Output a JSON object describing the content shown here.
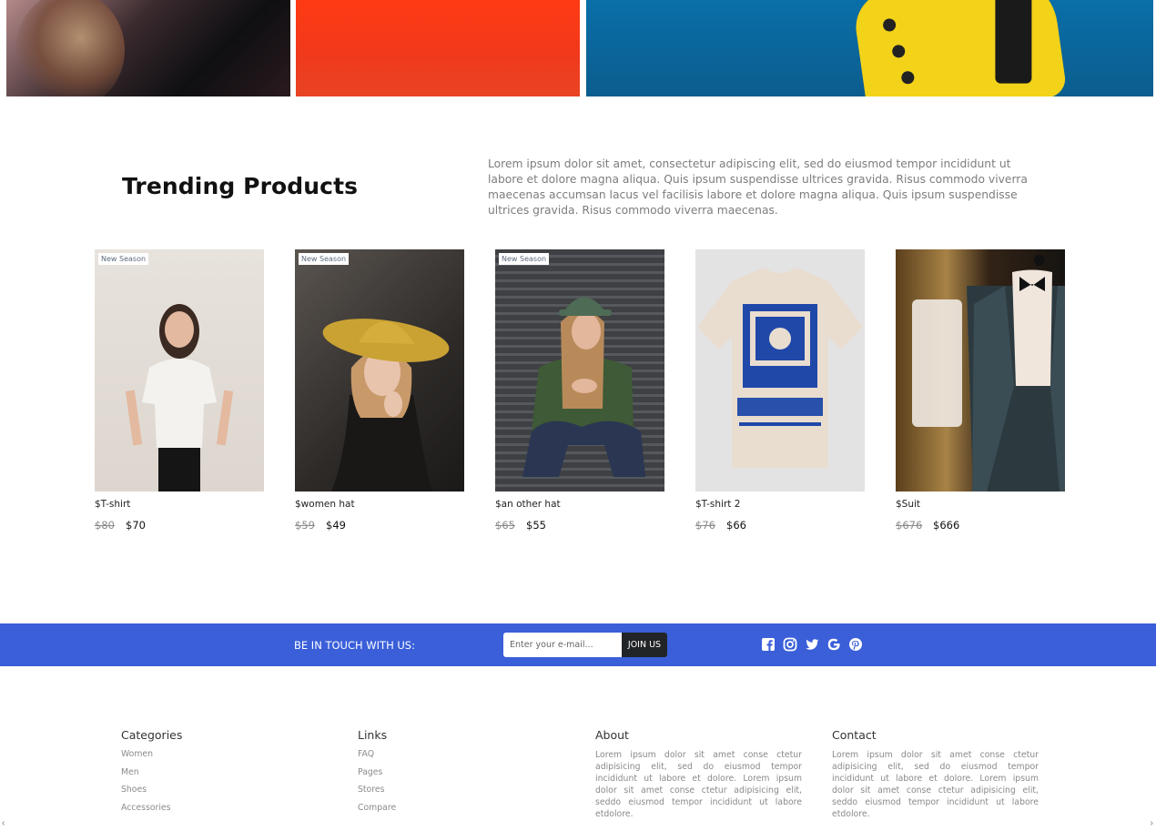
{
  "trending": {
    "title": "Trending Products",
    "description": "Lorem ipsum dolor sit amet, consectetur adipiscing elit, sed do eiusmod tempor incididunt ut labore et dolore magna aliqua. Quis ipsum suspendisse ultrices gravida. Risus commodo viverra maecenas accumsan lacus vel facilisis labore et dolore magna aliqua. Quis ipsum suspendisse ultrices gravida. Risus commodo viverra maecenas."
  },
  "products": [
    {
      "badge": "New Season",
      "name": "$T-shirt",
      "old_price": "$80",
      "new_price": "$70"
    },
    {
      "badge": "New Season",
      "name": "$women hat",
      "old_price": "$59",
      "new_price": "$49"
    },
    {
      "badge": "New Season",
      "name": "$an other hat",
      "old_price": "$65",
      "new_price": "$55"
    },
    {
      "badge": "",
      "name": "$T-shirt 2",
      "old_price": "$76",
      "new_price": "$66"
    },
    {
      "badge": "",
      "name": "$Suit",
      "old_price": "$676",
      "new_price": "$666"
    }
  ],
  "newsletter": {
    "label": "BE IN TOUCH WITH US:",
    "placeholder": "Enter your e-mail...",
    "button": "JOIN US",
    "accent": "#3a5fd9",
    "socials": [
      "facebook-icon",
      "instagram-icon",
      "twitter-icon",
      "google-icon",
      "pinterest-icon"
    ]
  },
  "footer": {
    "categories": {
      "title": "Categories",
      "items": [
        "Women",
        "Men",
        "Shoes",
        "Accessories"
      ]
    },
    "links": {
      "title": "Links",
      "items": [
        "FAQ",
        "Pages",
        "Stores",
        "Compare"
      ]
    },
    "about": {
      "title": "About",
      "text": "Lorem ipsum dolor sit amet conse ctetur adipisicing elit, sed do eiusmod tempor incididunt ut labore et dolore. Lorem ipsum dolor sit amet conse ctetur adipisicing elit, seddo eiusmod tempor incididunt ut labore etdolore."
    },
    "contact": {
      "title": "Contact",
      "text": "Lorem ipsum dolor sit amet conse ctetur adipisicing elit, sed do eiusmod tempor incididunt ut labore et dolore. Lorem ipsum dolor sit amet conse ctetur adipisicing elit, seddo eiusmod tempor incididunt ut labore etdolore."
    }
  }
}
